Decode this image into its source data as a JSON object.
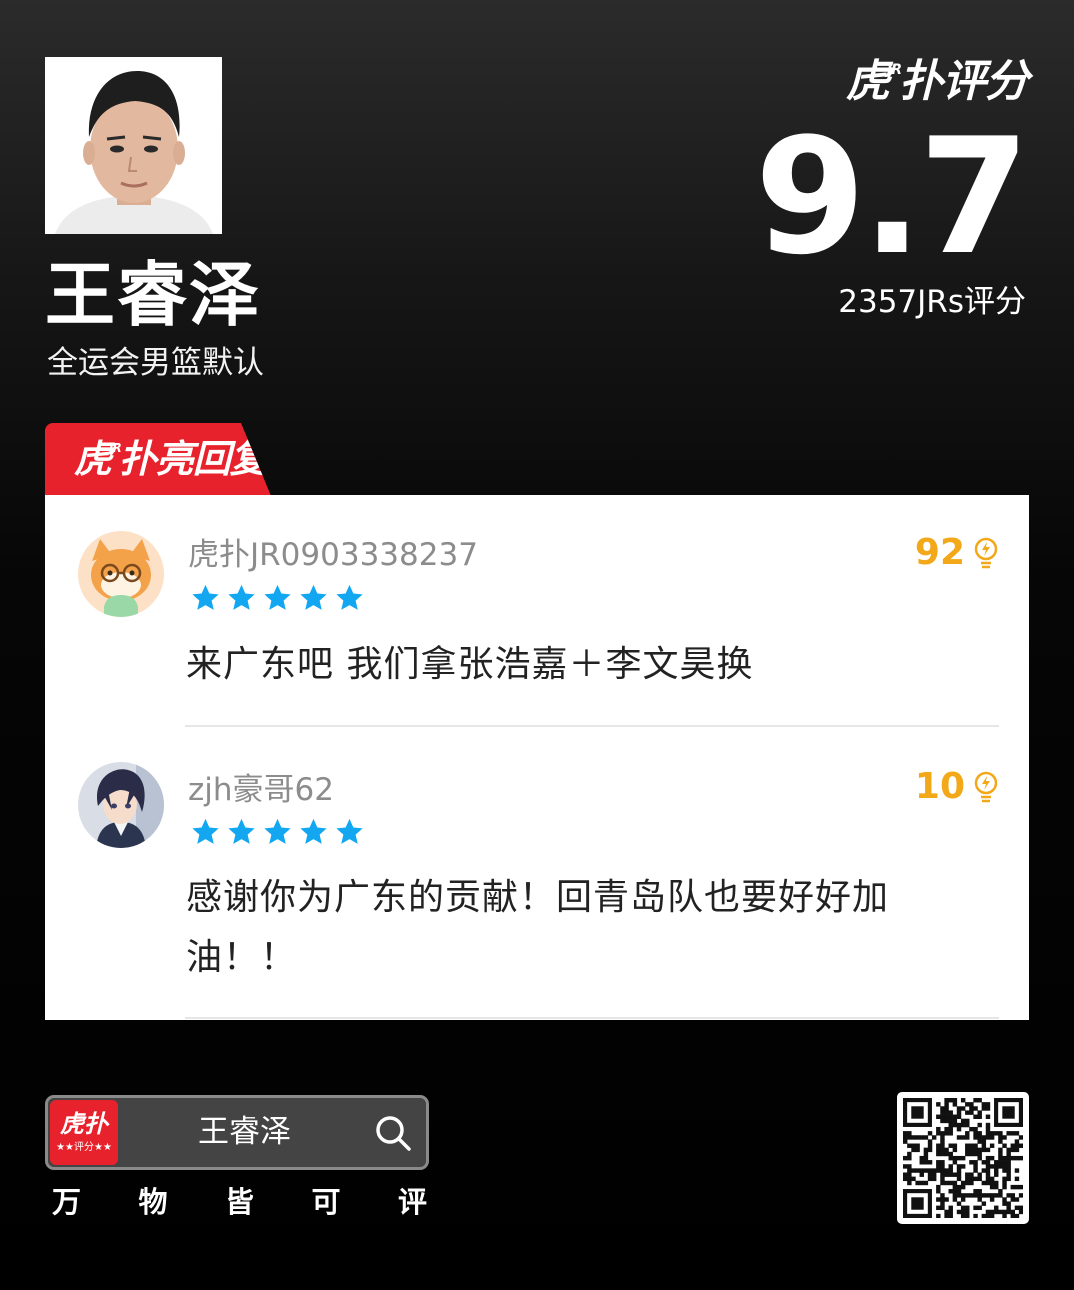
{
  "player": {
    "name": "王睿泽",
    "subtitle": "全运会男篮默认"
  },
  "brand": {
    "logo_part1": "虎",
    "logo_jr": "JR",
    "logo_part2": "扑评分"
  },
  "rating": {
    "score": "9.7",
    "votes": "2357JRs评分"
  },
  "highlight_tab": {
    "part1": "虎",
    "jr": "JR",
    "part2": "扑亮回复"
  },
  "comments": [
    {
      "user": "虎扑JR0903338237",
      "stars": 5,
      "likes": "92",
      "text": "来广东吧 我们拿张浩嘉＋李文昊换"
    },
    {
      "user": "zjh豪哥62",
      "stars": 5,
      "likes": "10",
      "text": "感谢你为广东的贡献！回青岛队也要好好加油！！"
    }
  ],
  "search_bar": {
    "app_icon_text": "虎扑",
    "app_icon_sub": "★★评分★★",
    "query": "王睿泽"
  },
  "slogan": [
    "万",
    "物",
    "皆",
    "可",
    "评"
  ],
  "colors": {
    "accent_red": "#e8222c",
    "star_blue": "#12a7f0",
    "likes_gold": "#f2a818"
  }
}
